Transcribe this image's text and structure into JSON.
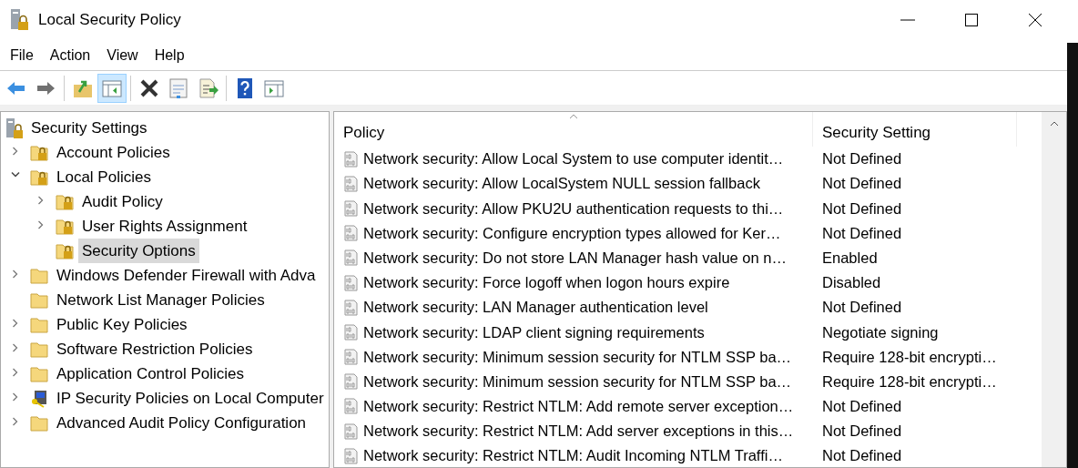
{
  "window": {
    "title": "Local Security Policy"
  },
  "menu": [
    "File",
    "Action",
    "View",
    "Help"
  ],
  "toolbar": [
    {
      "kind": "back",
      "pressed": false
    },
    {
      "kind": "forward",
      "pressed": false
    },
    {
      "kind": "sep"
    },
    {
      "kind": "up",
      "pressed": false
    },
    {
      "kind": "tree",
      "pressed": true
    },
    {
      "kind": "sep"
    },
    {
      "kind": "delete",
      "pressed": false
    },
    {
      "kind": "properties",
      "pressed": false
    },
    {
      "kind": "export",
      "pressed": false
    },
    {
      "kind": "sep"
    },
    {
      "kind": "help",
      "pressed": false
    },
    {
      "kind": "pane",
      "pressed": false
    }
  ],
  "tree": {
    "label": "Security Settings",
    "children": [
      {
        "label": "Account Policies",
        "kind": "lockfolder",
        "expanded": false,
        "selected": false
      },
      {
        "label": "Local Policies",
        "kind": "lockfolder",
        "expanded": true,
        "selected": false,
        "children": [
          {
            "label": "Audit Policy",
            "kind": "lockfolder",
            "expanded": false,
            "selected": false
          },
          {
            "label": "User Rights Assignment",
            "kind": "lockfolder",
            "expanded": false,
            "selected": false
          },
          {
            "label": "Security Options",
            "kind": "lockfolder",
            "selected": true
          }
        ]
      },
      {
        "label": "Windows Defender Firewall with Adva",
        "kind": "folder",
        "expanded": false,
        "selected": false
      },
      {
        "label": "Network List Manager Policies",
        "kind": "folder",
        "selected": false
      },
      {
        "label": "Public Key Policies",
        "kind": "folder",
        "expanded": false,
        "selected": false
      },
      {
        "label": "Software Restriction Policies",
        "kind": "folder",
        "expanded": false,
        "selected": false
      },
      {
        "label": "Application Control Policies",
        "kind": "folder",
        "expanded": false,
        "selected": false
      },
      {
        "label": "IP Security Policies on Local Computer",
        "kind": "computer",
        "expanded": false,
        "selected": false
      },
      {
        "label": "Advanced Audit Policy Configuration",
        "kind": "folder",
        "expanded": false,
        "selected": false
      }
    ]
  },
  "table": {
    "columns": [
      "Policy",
      "Security Setting"
    ],
    "rows": [
      [
        "Network security: Allow Local System to use computer identit…",
        "Not Defined"
      ],
      [
        "Network security: Allow LocalSystem NULL session fallback",
        "Not Defined"
      ],
      [
        "Network security: Allow PKU2U authentication requests to thi…",
        "Not Defined"
      ],
      [
        "Network security: Configure encryption types allowed for Ker…",
        "Not Defined"
      ],
      [
        "Network security: Do not store LAN Manager hash value on n…",
        "Enabled"
      ],
      [
        "Network security: Force logoff when logon hours expire",
        "Disabled"
      ],
      [
        "Network security: LAN Manager authentication level",
        "Not Defined"
      ],
      [
        "Network security: LDAP client signing requirements",
        "Negotiate signing"
      ],
      [
        "Network security: Minimum session security for NTLM SSP ba…",
        "Require 128-bit encrypti…"
      ],
      [
        "Network security: Minimum session security for NTLM SSP ba…",
        "Require 128-bit encrypti…"
      ],
      [
        "Network security: Restrict NTLM: Add remote server exception…",
        "Not Defined"
      ],
      [
        "Network security: Restrict NTLM: Add server exceptions in this…",
        "Not Defined"
      ],
      [
        "Network security: Restrict NTLM: Audit Incoming NTLM Traffi…",
        "Not Defined"
      ]
    ]
  }
}
